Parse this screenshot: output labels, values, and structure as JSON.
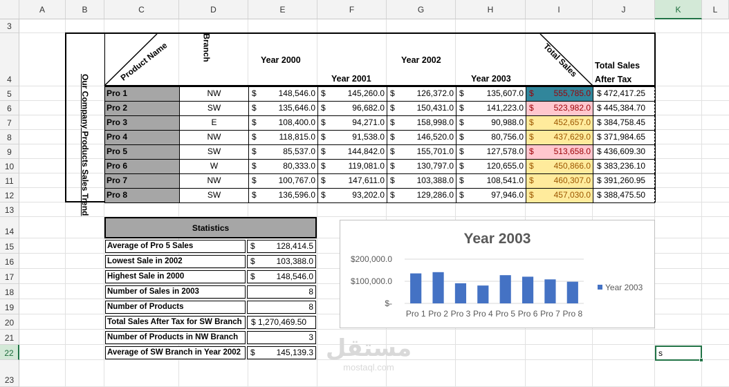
{
  "sheet": {
    "columns": [
      "A",
      "B",
      "C",
      "D",
      "E",
      "F",
      "G",
      "H",
      "I",
      "J",
      "K",
      "L"
    ],
    "rows": [
      "3",
      "4",
      "5",
      "6",
      "7",
      "8",
      "9",
      "10",
      "11",
      "12",
      "13",
      "14",
      "15",
      "16",
      "17",
      "18",
      "19",
      "20",
      "21",
      "22",
      "23"
    ],
    "active_cell_value": "s"
  },
  "table": {
    "vertical_title": "Our Company Products Sales Trend",
    "product_name_header": "Product Name",
    "branch_header": "Branch",
    "year_headers": [
      "Year 2000",
      "Year 2001",
      "Year 2002",
      "Year 2003"
    ],
    "total_sales_header": "Total Sales",
    "after_tax_header": "Total Sales After Tax",
    "currency_symbol": "$",
    "rows": [
      {
        "name": "Pro 1",
        "branch": "NW",
        "y2000": "148,546.0",
        "y2001": "145,260.0",
        "y2002": "126,372.0",
        "y2003": "135,607.0",
        "total": "555,785.0",
        "after_tax": "$ 472,417.25",
        "highlight": "blue"
      },
      {
        "name": "Pro 2",
        "branch": "SW",
        "y2000": "135,646.0",
        "y2001": "96,682.0",
        "y2002": "150,431.0",
        "y2003": "141,223.0",
        "total": "523,982.0",
        "after_tax": "$ 445,384.70",
        "highlight": "red"
      },
      {
        "name": "Pro 3",
        "branch": "E",
        "y2000": "108,400.0",
        "y2001": "94,271.0",
        "y2002": "158,998.0",
        "y2003": "90,988.0",
        "total": "452,657.0",
        "after_tax": "$ 384,758.45",
        "highlight": "yellow"
      },
      {
        "name": "Pro 4",
        "branch": "NW",
        "y2000": "118,815.0",
        "y2001": "91,538.0",
        "y2002": "146,520.0",
        "y2003": "80,756.0",
        "total": "437,629.0",
        "after_tax": "$ 371,984.65",
        "highlight": "yellow"
      },
      {
        "name": "Pro 5",
        "branch": "SW",
        "y2000": "85,537.0",
        "y2001": "144,842.0",
        "y2002": "155,701.0",
        "y2003": "127,578.0",
        "total": "513,658.0",
        "after_tax": "$ 436,609.30",
        "highlight": "red"
      },
      {
        "name": "Pro 6",
        "branch": "W",
        "y2000": "80,333.0",
        "y2001": "119,081.0",
        "y2002": "130,797.0",
        "y2003": "120,655.0",
        "total": "450,866.0",
        "after_tax": "$ 383,236.10",
        "highlight": "yellow"
      },
      {
        "name": "Pro 7",
        "branch": "NW",
        "y2000": "100,767.0",
        "y2001": "147,611.0",
        "y2002": "103,388.0",
        "y2003": "108,541.0",
        "total": "460,307.0",
        "after_tax": "$ 391,260.95",
        "highlight": "yellow"
      },
      {
        "name": "Pro 8",
        "branch": "SW",
        "y2000": "136,596.0",
        "y2001": "93,202.0",
        "y2002": "129,286.0",
        "y2003": "97,946.0",
        "total": "457,030.0",
        "after_tax": "$ 388,475.50",
        "highlight": "yellow"
      }
    ]
  },
  "stats": {
    "title": "Statistics",
    "rows": [
      {
        "label": "Average of Pro 5 Sales",
        "currency": "$",
        "value": "128,414.5"
      },
      {
        "label": "Lowest Sale in 2002",
        "currency": "$",
        "value": "103,388.0"
      },
      {
        "label": "Highest Sale in 2000",
        "currency": "$",
        "value": "148,546.0"
      },
      {
        "label": "Number of Sales in 2003",
        "currency": "",
        "value": "8"
      },
      {
        "label": "Number of Products",
        "currency": "",
        "value": "8"
      },
      {
        "label": "Total Sales After Tax for SW Branch",
        "currency": "",
        "value": "$ 1,270,469.50"
      },
      {
        "label": "Number of Products in NW Branch",
        "currency": "",
        "value": "3"
      },
      {
        "label": "Average of SW Branch in Year 2002",
        "currency": "$",
        "value": "145,139.3"
      }
    ]
  },
  "chart_data": {
    "type": "bar",
    "title": "Year 2003",
    "categories": [
      "Pro 1",
      "Pro 2",
      "Pro 3",
      "Pro 4",
      "Pro 5",
      "Pro 6",
      "Pro 7",
      "Pro 8"
    ],
    "series": [
      {
        "name": "Year 2003",
        "values": [
          135607,
          141223,
          90988,
          80756,
          127578,
          120655,
          108541,
          97946
        ]
      }
    ],
    "ylim": [
      0,
      200000
    ],
    "yticks": [
      "$-",
      "$100,000.0",
      "$200,000.0"
    ],
    "legend": "right",
    "bar_color": "#4472c4"
  },
  "watermark": {
    "arabic": "مستقل",
    "latin": "mostaql.com"
  }
}
